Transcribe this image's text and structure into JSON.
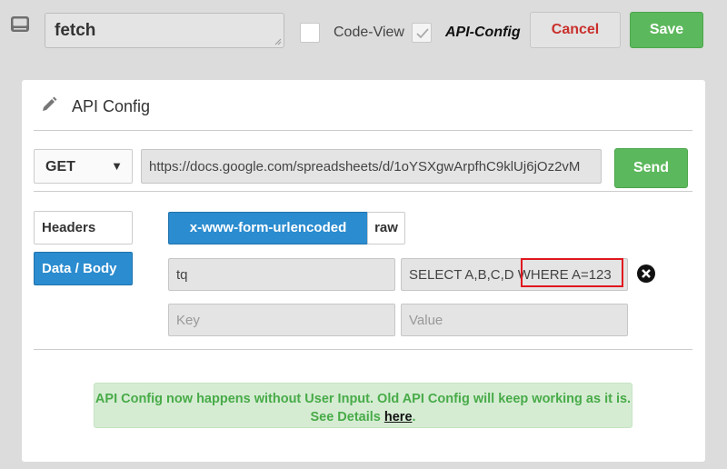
{
  "toolbar": {
    "name_value": "fetch",
    "code_view_label": "Code-View",
    "code_view_checked": false,
    "api_config_label": "API-Config",
    "api_config_checked": true,
    "cancel_label": "Cancel",
    "save_label": "Save",
    "icon": "monitor-icon"
  },
  "panel": {
    "title": "API Config",
    "icon": "pencil-icon",
    "method": "GET",
    "url": "https://docs.google.com/spreadsheets/d/1oYSXgwArpfhC9klUj6jOz2vM",
    "send_label": "Send",
    "tabs": [
      {
        "label": "Headers",
        "active": false
      },
      {
        "label": "Data / Body",
        "active": true
      }
    ],
    "body_types": [
      {
        "label": "x-www-form-urlencoded",
        "active": true
      },
      {
        "label": "raw",
        "active": false
      }
    ],
    "params": [
      {
        "key": "tq",
        "value": "SELECT A,B,C,D WHERE A=123"
      }
    ],
    "new_param_placeholders": {
      "key": "Key",
      "value": "Value"
    },
    "notice": {
      "text": "API Config now happens without User Input. Old API Config will keep working as it is. See Details",
      "link": "here",
      "suffix": "."
    }
  },
  "colors": {
    "primary_blue": "#2b8ccf",
    "success_green": "#5cb85c",
    "cancel_red": "#c9302c",
    "highlight_red": "#e0161e",
    "notice_bg": "#d5ecd3",
    "notice_text": "#48ab48"
  }
}
